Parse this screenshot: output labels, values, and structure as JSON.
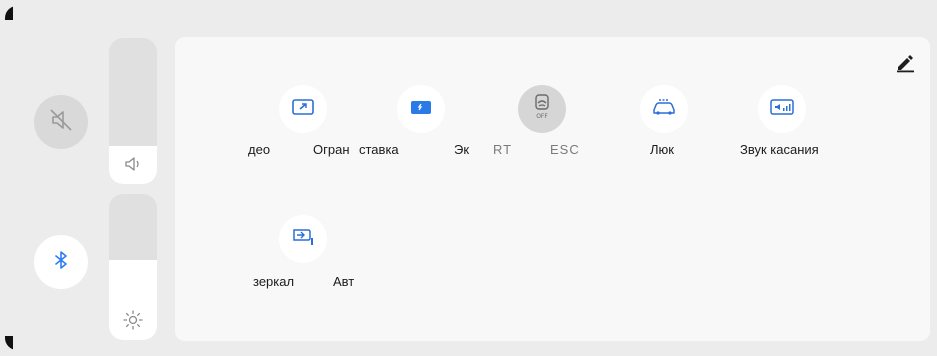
{
  "left": {
    "mute_icon": "speaker-muted-icon",
    "bluetooth_icon": "bluetooth-icon",
    "volume_icon": "speaker-icon",
    "brightness_icon": "sun-icon",
    "volume_level": 0.26,
    "brightness_level": 0.55
  },
  "panel": {
    "edit_icon": "pencil-icon",
    "tiles": [
      {
        "label": "део",
        "icon": "screen-cast-icon"
      },
      {
        "label": "Огран",
        "icon": ""
      },
      {
        "label": "ставка",
        "icon": "screensaver-icon"
      },
      {
        "label": "Эк",
        "icon": ""
      },
      {
        "label": "RT",
        "icon": ""
      },
      {
        "label": "ESC",
        "icon": "esc-off-icon"
      },
      {
        "label": "Люк",
        "icon": "sunroof-icon"
      },
      {
        "label": "Звук касания",
        "icon": "touch-sound-icon"
      },
      {
        "label": "зеркал",
        "icon": "mirror-icon"
      },
      {
        "label": "Авт",
        "icon": ""
      }
    ],
    "esc_off_text": "OFF"
  }
}
